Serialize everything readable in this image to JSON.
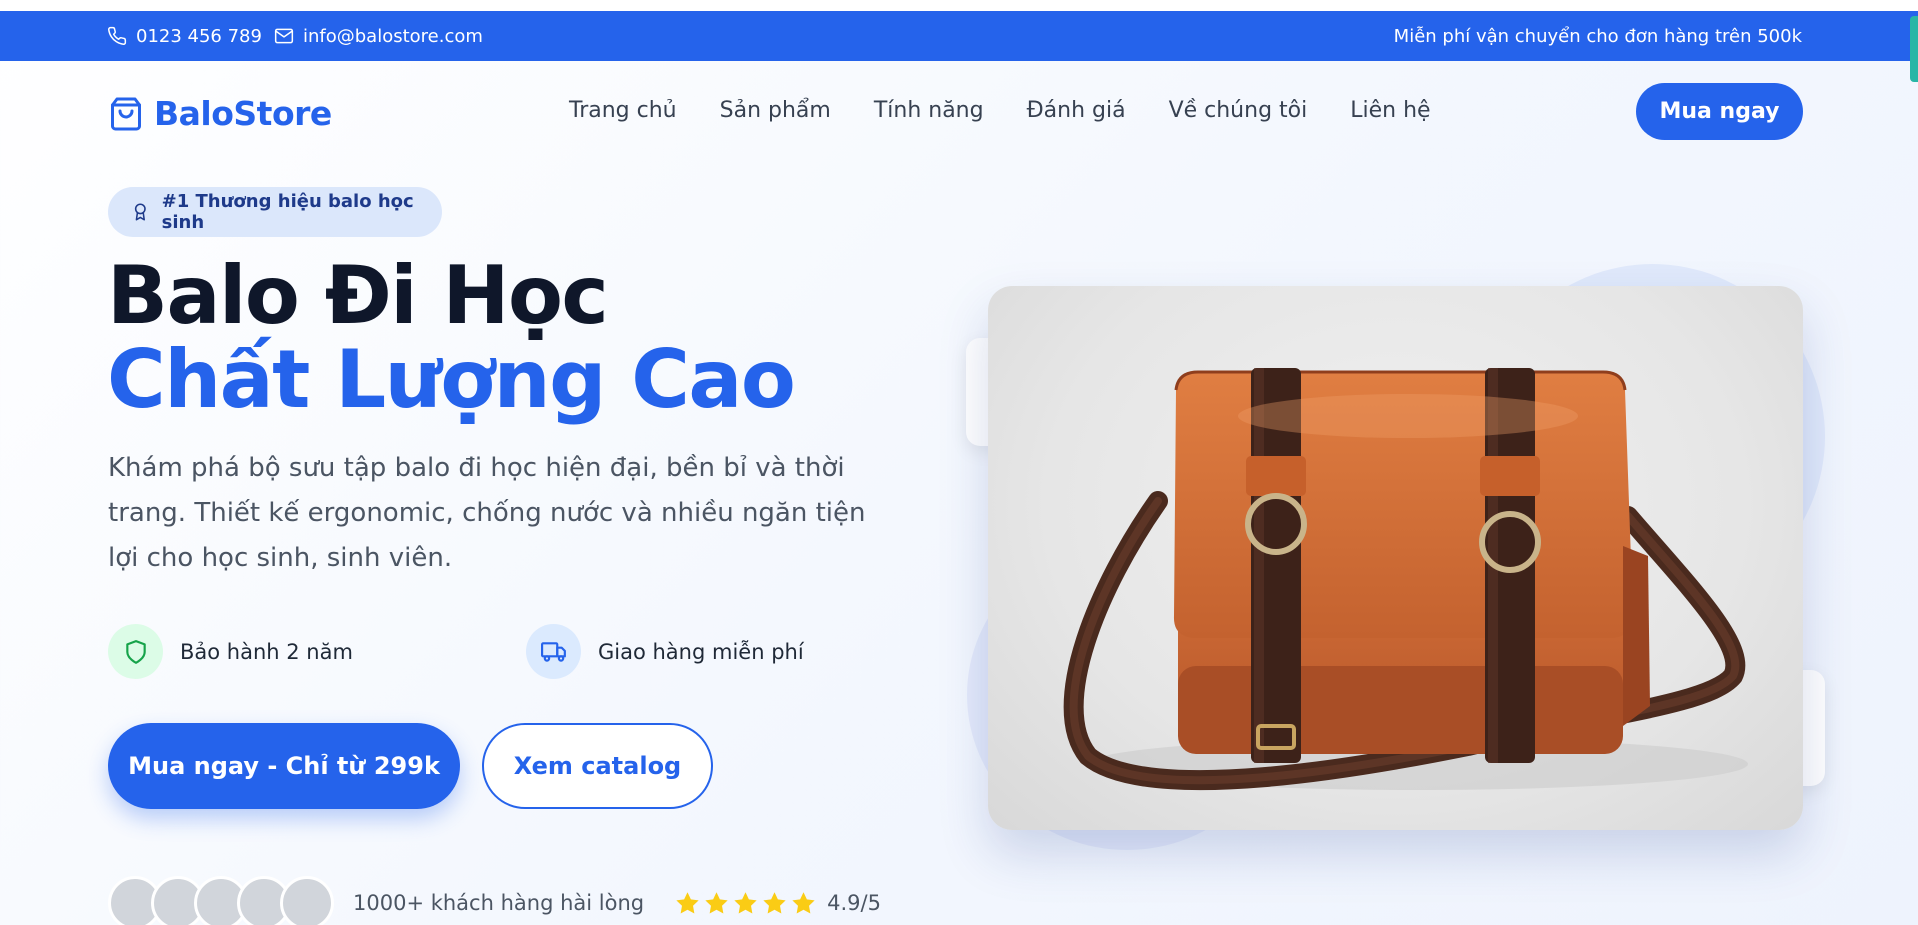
{
  "topbar": {
    "phone": "0123 456 789",
    "email": "info@balostore.com",
    "promo": "Miễn phí vận chuyển cho đơn hàng trên 500k"
  },
  "brand": {
    "name": "BaloStore",
    "icon": "shopping-bag-icon",
    "color": "#2563eb"
  },
  "nav": {
    "links": [
      "Trang chủ",
      "Sản phẩm",
      "Tính năng",
      "Đánh giá",
      "Về chúng tôi",
      "Liên hệ"
    ],
    "cta": "Mua ngay"
  },
  "hero": {
    "badge": "#1 Thương hiệu balo học sinh",
    "title_line1": "Balo Đi Học",
    "title_line2": "Chất Lượng Cao",
    "description": "Khám phá bộ sưu tập balo đi học hiện đại, bền bỉ và thời trang. Thiết kế ergonomic, chống nước và nhiều ngăn tiện lợi cho học sinh, sinh viên.",
    "features": [
      {
        "label": "Bảo hành 2 năm",
        "icon": "shield-icon",
        "color": "#16a34a"
      },
      {
        "label": "Giao hàng miễn phí",
        "icon": "truck-icon",
        "color": "#2563eb"
      }
    ],
    "primary_button": "Mua ngay - Chỉ từ 299k",
    "secondary_button": "Xem catalog",
    "customers": "1000+ khách hàng hài lòng",
    "stars": 5,
    "rating": "4.9/5",
    "image": "brown leather messenger bag photo"
  },
  "colors": {
    "accent": "#2563eb",
    "star": "#facc15"
  }
}
